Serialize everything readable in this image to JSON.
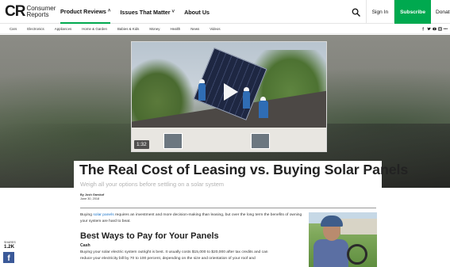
{
  "header": {
    "logo_mark": "CR",
    "logo_text": "Consumer Reports",
    "nav": [
      {
        "label": "Product Reviews",
        "has_dropdown": true,
        "active": true
      },
      {
        "label": "Issues That Matter",
        "has_dropdown": true,
        "active": false
      },
      {
        "label": "About Us",
        "has_dropdown": false,
        "active": false
      }
    ],
    "sign_in": "Sign In",
    "subscribe": "Subscribe",
    "donate": "Donate"
  },
  "subnav": {
    "items": [
      "Cars",
      "Electronics",
      "Appliances",
      "Home & Garden",
      "Babies & Kids",
      "Money",
      "Health",
      "News",
      "Videos"
    ],
    "social_icons": [
      "facebook-icon",
      "twitter-icon",
      "youtube-icon",
      "instagram-icon",
      "more-icon"
    ]
  },
  "video": {
    "duration": "1:32"
  },
  "article": {
    "title": "The Real Cost of Leasing vs. Buying Solar Panels",
    "subtitle": "Weigh all your options before settling on a solar system",
    "author": "By Josh Garskof",
    "date": "June 30, 2018",
    "intro_before": "Buying ",
    "intro_link": "solar panels",
    "intro_after": " requires an investment and more decision-making than leasing, but over the long term the benefits of owning your system are hard to beat.",
    "section_heading": "Best Ways to Pay for Your Panels",
    "subsection_heading": "Cash",
    "body": "Buying your solar electric system outright is best. It usually costs $15,000 to $20,000 after tax credits and can reduce your electricity bill by 70 to 100 percent, depending on the size and orientation of your roof and"
  },
  "share": {
    "label": "SHARES",
    "count": "1.2K"
  },
  "colors": {
    "brand_green": "#00a94f",
    "link_blue": "#1a73c8",
    "facebook_blue": "#3b5998"
  }
}
